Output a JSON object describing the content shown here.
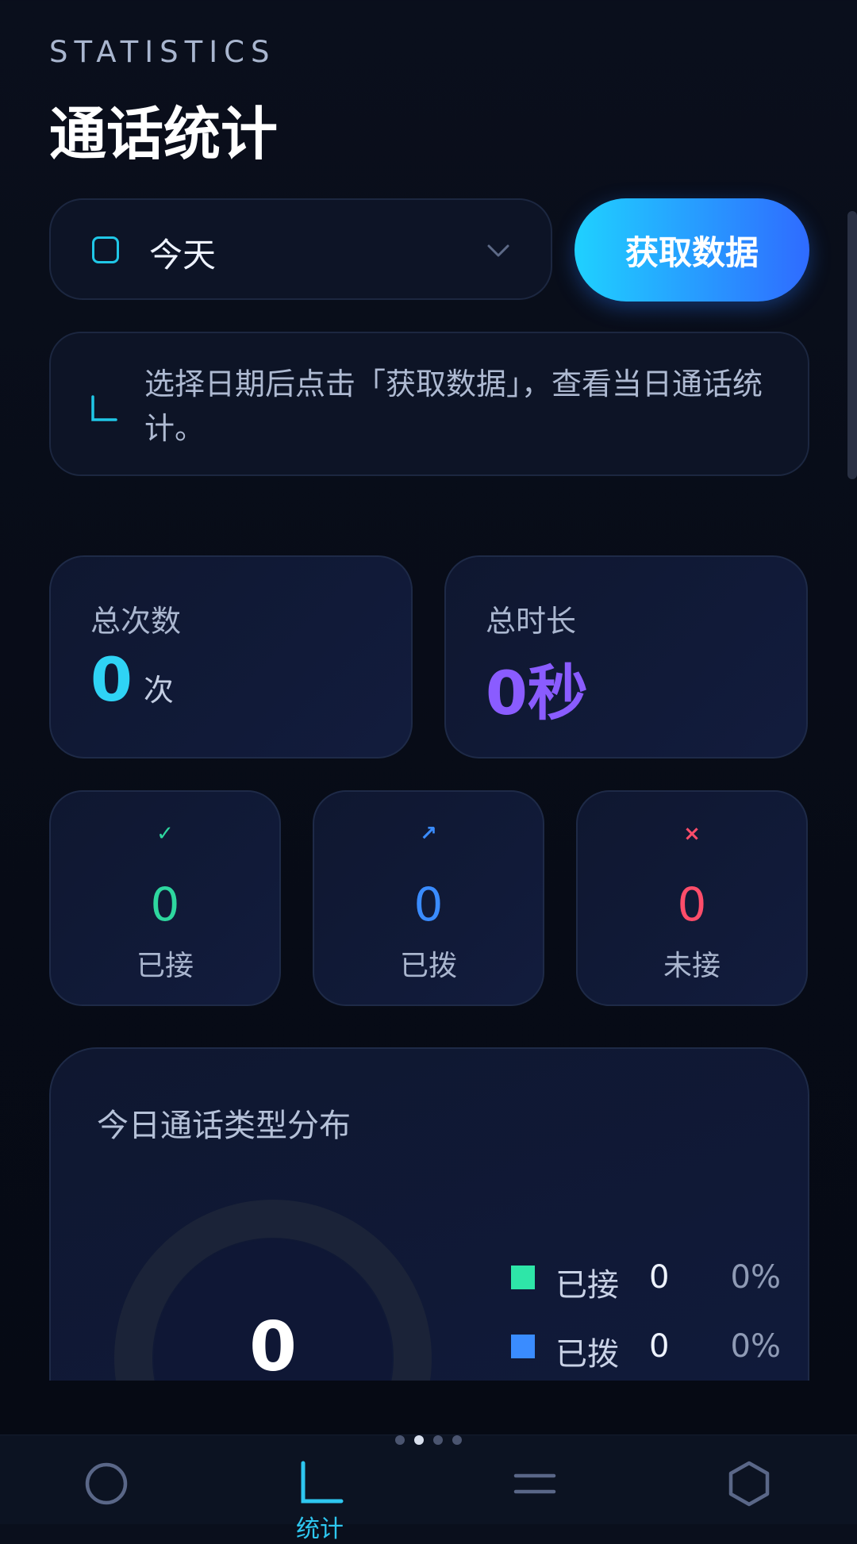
{
  "header": {
    "eyebrow": "STATISTICS",
    "title": "通话统计"
  },
  "date_picker": {
    "icon": "calendar-icon",
    "value": "今天",
    "chevron": "chevron-down-icon"
  },
  "fetch_button": {
    "label": "获取数据"
  },
  "hint": {
    "icon": "chart-icon",
    "text": "选择日期后点击「获取数据」，查看当日通话统计。"
  },
  "stats": {
    "total_count": {
      "label": "总次数",
      "value": "0",
      "unit": "次",
      "color": "#2fd3f5"
    },
    "total_duration": {
      "label": "总时长",
      "value": "0秒",
      "color": "#8a5cff"
    }
  },
  "breakdown": [
    {
      "icon": "✓",
      "icon_name": "call-received-icon",
      "value": "0",
      "label": "已接",
      "color": "#2ed79f"
    },
    {
      "icon": "↗",
      "icon_name": "call-outgoing-icon",
      "value": "0",
      "label": "已拨",
      "color": "#3a8cff"
    },
    {
      "icon": "×",
      "icon_name": "call-missed-icon",
      "value": "0",
      "label": "未接",
      "color": "#ff4d6a"
    }
  ],
  "distribution": {
    "title": "今日通话类型分布",
    "center_value": "0",
    "legend": [
      {
        "name": "已接",
        "count": "0",
        "percent": "0%",
        "color": "#2ee6a8"
      },
      {
        "name": "已拨",
        "count": "0",
        "percent": "0%",
        "color": "#3a8cff"
      }
    ]
  },
  "pager": {
    "count": 4,
    "active": 1
  },
  "bottom_nav": {
    "items": [
      {
        "icon": "circle-icon"
      },
      {
        "icon": "chart-icon",
        "label": "统计",
        "active": true
      },
      {
        "icon": "menu-icon"
      },
      {
        "icon": "hexagon-icon"
      }
    ]
  }
}
